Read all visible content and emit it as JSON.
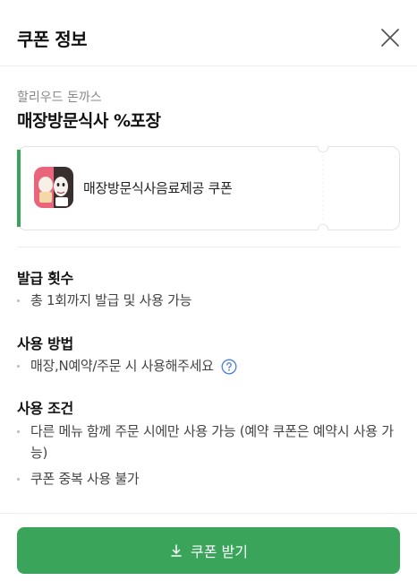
{
  "header": {
    "title": "쿠폰 정보",
    "close_icon": "close-icon"
  },
  "coupon": {
    "store_name": "할리우드 돈까스",
    "title": "매장방문식사 %포장",
    "card": {
      "name": "매장방문식사음료제공 쿠폰",
      "thumbnail": "coupon-thumbnail-image",
      "accent_color": "#3aa55a"
    }
  },
  "sections": {
    "issue": {
      "title": "발급 횟수",
      "items": [
        "총 1회까지 발급 및 사용 가능"
      ]
    },
    "usage": {
      "title": "사용 방법",
      "items": [
        "매장,N예약/주문 시 사용해주세요"
      ],
      "help_icon": "question-circle-icon"
    },
    "conditions": {
      "title": "사용 조건",
      "items": [
        "다른 메뉴 함께 주문 시에만 사용 가능 (예약 쿠폰은 예약시 사용 가능)",
        "쿠폰 중복 사용 불가"
      ]
    }
  },
  "action": {
    "label": "쿠폰 받기",
    "icon": "download-icon",
    "color": "#3aa55a"
  }
}
